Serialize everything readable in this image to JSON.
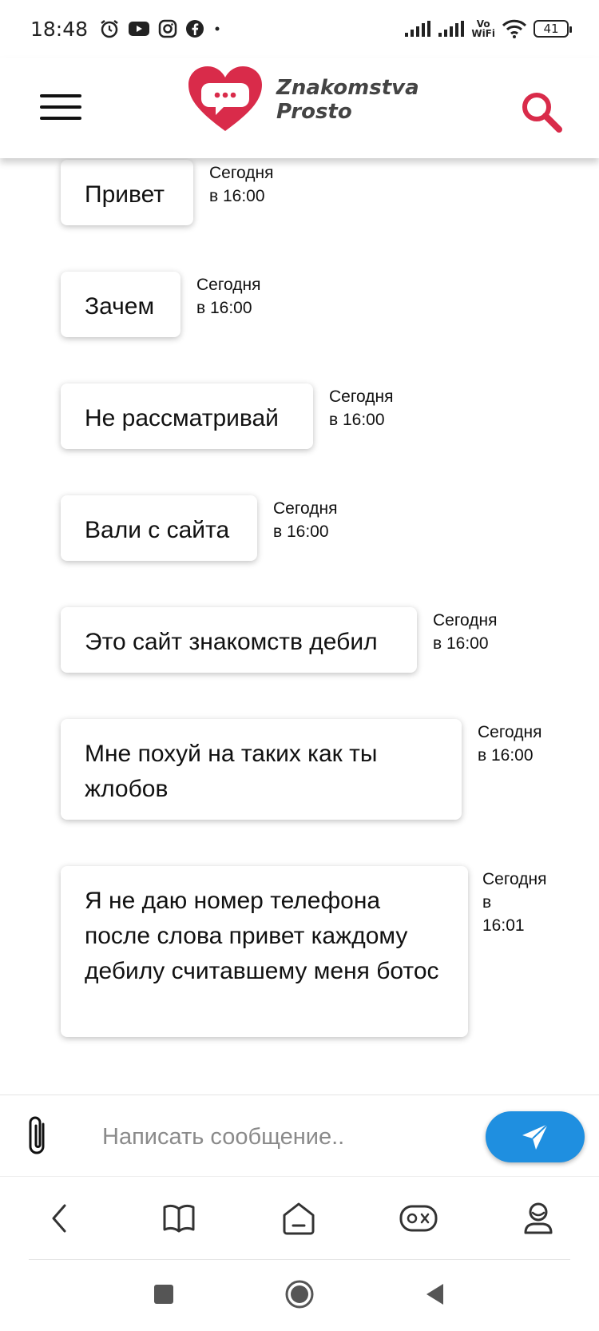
{
  "status_bar": {
    "time": "18:48",
    "wifi_label_top": "Vo",
    "wifi_label_bottom": "WiFi",
    "battery": "41"
  },
  "header": {
    "logo_line1": "Znakomstva",
    "logo_line2": "Prosto",
    "brand_color": "#d92b4a"
  },
  "messages": [
    {
      "text": "Привет",
      "time_line1": "Сегодня",
      "time_line2": "в 16:00"
    },
    {
      "text": "Зачем",
      "time_line1": "Сегодня",
      "time_line2": "в 16:00"
    },
    {
      "text": "Не рассматривай",
      "time_line1": "Сегодня",
      "time_line2": "в 16:00"
    },
    {
      "text": "Вали с сайта",
      "time_line1": "Сегодня",
      "time_line2": "в 16:00"
    },
    {
      "text": "Это сайт знакомств дебил",
      "time_line1": "Сегодня",
      "time_line2": "в 16:00"
    },
    {
      "text": "Мне похуй на таких как ты жлобов",
      "time_line1": "Сегодня",
      "time_line2": "в 16:00"
    },
    {
      "text": "Я не даю номер телефона после слова привет каждому дебилу считавшему меня ботос",
      "time_line1": "Сегодня",
      "time_line2": "в",
      "time_line3": "16:01"
    }
  ],
  "composer": {
    "placeholder": "Написать сообщение..",
    "value": "",
    "send_color": "#1f8fe0"
  }
}
